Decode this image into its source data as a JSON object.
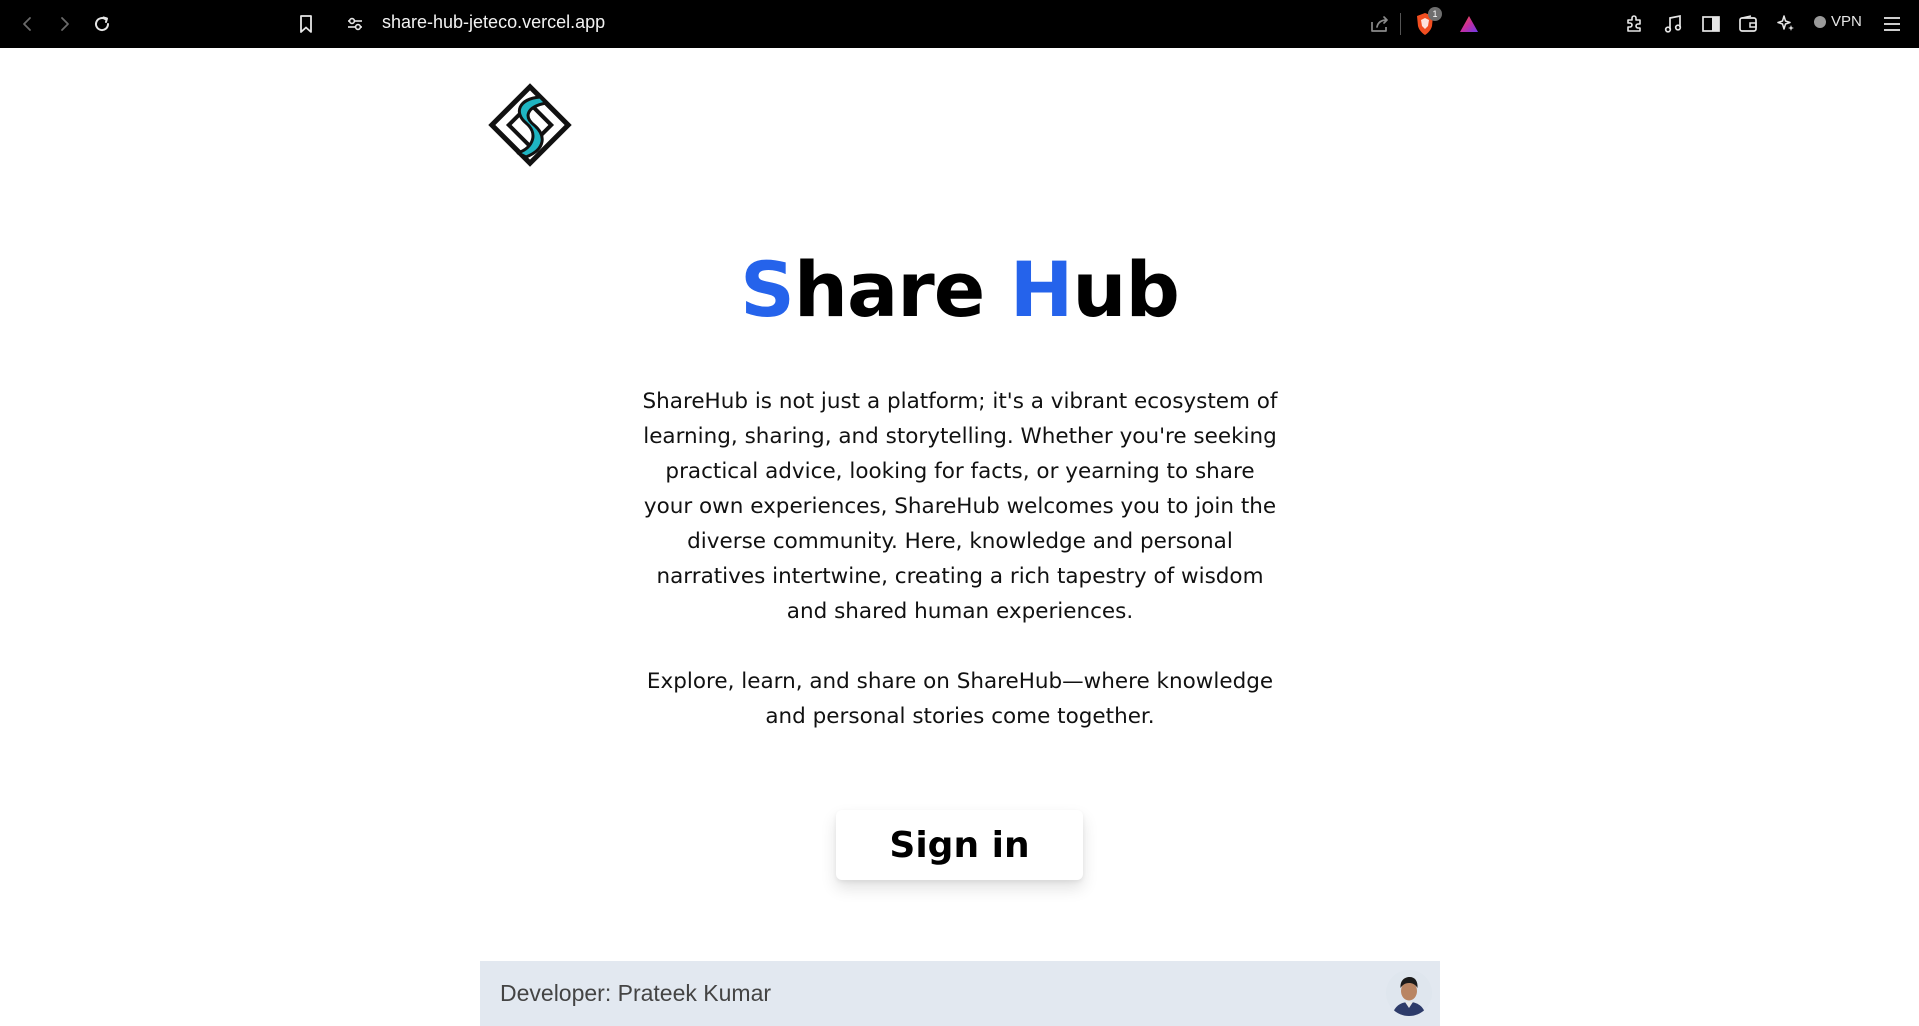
{
  "browser": {
    "url": "share-hub-jeteco.vercel.app",
    "shield_badge_count": "1",
    "vpn_label": "VPN"
  },
  "page": {
    "title_s": "S",
    "title_hare": "hare ",
    "title_h": "H",
    "title_ub": "ub",
    "intro_paragraph": "ShareHub is not just a platform; it's a vibrant ecosystem of learning, sharing, and storytelling. Whether you're seeking practical advice, looking for facts, or yearning to share your own experiences, ShareHub welcomes you to join the diverse community. Here, knowledge and personal narratives intertwine, creating a rich tapestry of wisdom and shared human experiences.",
    "explore_paragraph": "Explore, learn, and share on ShareHub—where knowledge and personal stories come together.",
    "signin_label": "Sign in"
  },
  "footer": {
    "developer_text": "Developer: Prateek Kumar"
  },
  "colors": {
    "accent": "#2563eb",
    "logo_teal": "#1fb5c2",
    "footer_bg": "#e2e8f0"
  },
  "icons": [
    "back-icon",
    "forward-icon",
    "reload-icon",
    "bookmark-icon",
    "site-settings-icon",
    "share-icon",
    "brave-shields-icon",
    "brave-rewards-icon",
    "extensions-icon",
    "media-icon",
    "sidebar-icon",
    "wallet-icon",
    "leo-ai-icon",
    "menu-icon"
  ]
}
